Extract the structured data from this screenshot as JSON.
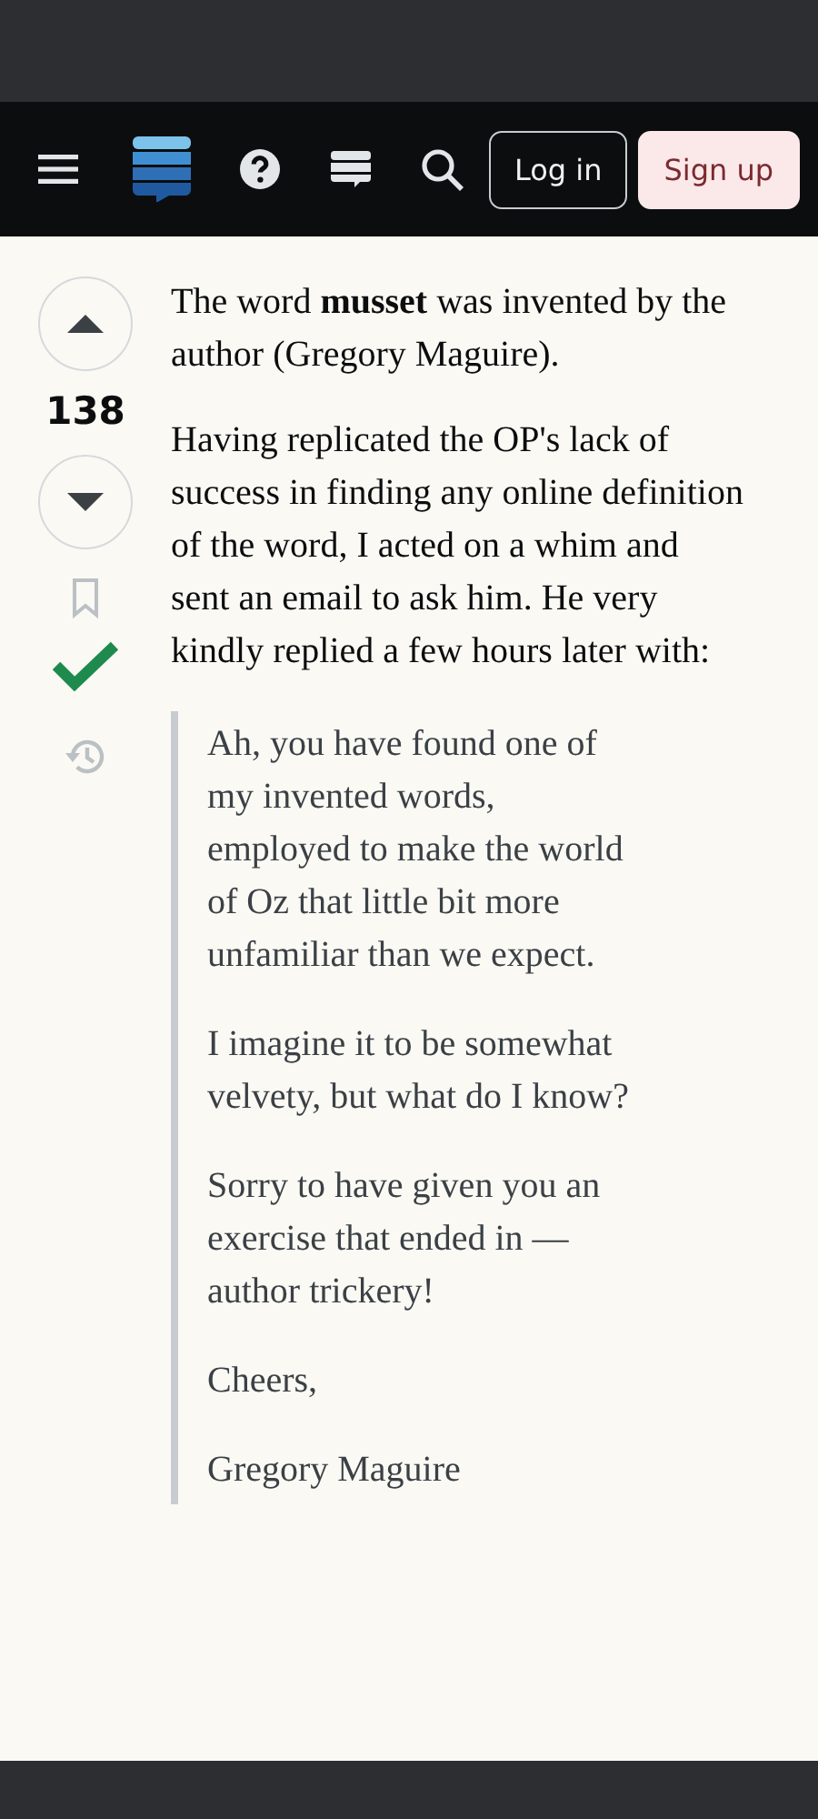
{
  "header": {
    "buttons": [
      {
        "label": "Log in",
        "kind": "outline"
      },
      {
        "label": "Sign up",
        "kind": "filled"
      }
    ]
  },
  "answer": {
    "score": "138",
    "accepted": true,
    "bookmarked": false,
    "paragraphs": [
      "The word **musset** was invented by the author (Gregory Maguire).",
      "Having replicated the OP's lack of success in finding any online definition of the word, I acted on a whim and sent an email to ask him. He very kindly replied a few hours later with:"
    ],
    "quote": [
      "Ah, you have found one of my invented words, employed to make the world of Oz that little bit more unfamiliar than we expect.",
      "I imagine it to be somewhat velvety, but what do I know?",
      "Sorry to have given you an exercise that ended in — author trickery!",
      "Cheers,",
      "Gregory Maguire"
    ]
  }
}
